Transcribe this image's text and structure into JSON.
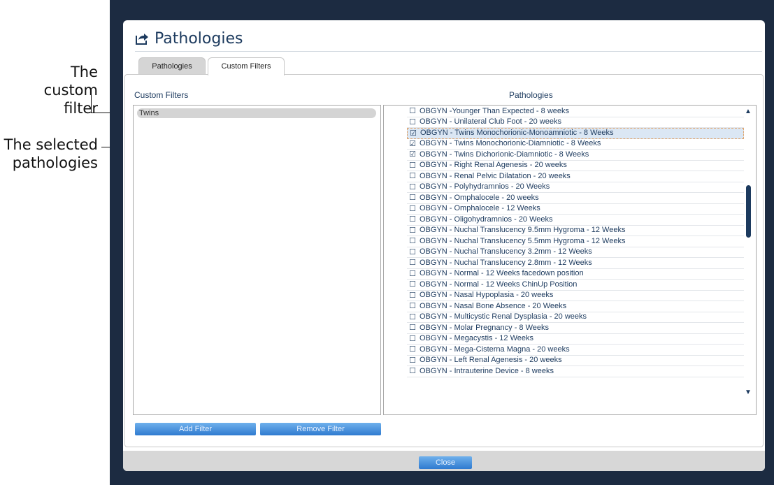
{
  "annotations": {
    "custom_filter": "The custom filter",
    "selected_pathologies": "The selected pathologies"
  },
  "dialog": {
    "title": "Pathologies",
    "icon": "export-arrow-icon"
  },
  "tabs": [
    {
      "label": "Pathologies",
      "active": false
    },
    {
      "label": "Custom Filters",
      "active": true
    }
  ],
  "custom_filters": {
    "header": "Custom Filters",
    "items": [
      "Twins"
    ]
  },
  "pathologies": {
    "header": "Pathologies",
    "items": [
      {
        "label": "OBGYN -Younger Than Expected - 8 weeks",
        "checked": false,
        "selected": false
      },
      {
        "label": "OBGYN - Unilateral Club Foot - 20 weeks",
        "checked": false,
        "selected": false
      },
      {
        "label": "OBGYN - Twins Monochorionic-Monoamniotic - 8 Weeks",
        "checked": true,
        "selected": true
      },
      {
        "label": "OBGYN - Twins Monochorionic-Diamniotic - 8 Weeks",
        "checked": true,
        "selected": false
      },
      {
        "label": "OBGYN - Twins Dichorionic-Diamniotic - 8 Weeks",
        "checked": true,
        "selected": false
      },
      {
        "label": "OBGYN - Right Renal Agenesis - 20 weeks",
        "checked": false,
        "selected": false
      },
      {
        "label": "OBGYN - Renal Pelvic Dilatation - 20 weeks",
        "checked": false,
        "selected": false
      },
      {
        "label": "OBGYN - Polyhydramnios - 20 Weeks",
        "checked": false,
        "selected": false
      },
      {
        "label": "OBGYN - Omphalocele - 20 weeks",
        "checked": false,
        "selected": false
      },
      {
        "label": "OBGYN - Omphalocele - 12 Weeks",
        "checked": false,
        "selected": false
      },
      {
        "label": "OBGYN - Oligohydramnios - 20 Weeks",
        "checked": false,
        "selected": false
      },
      {
        "label": "OBGYN - Nuchal Translucency 9.5mm Hygroma - 12 Weeks",
        "checked": false,
        "selected": false
      },
      {
        "label": "OBGYN - Nuchal Translucency 5.5mm Hygroma - 12 Weeks",
        "checked": false,
        "selected": false
      },
      {
        "label": "OBGYN - Nuchal Translucency 3.2mm - 12 Weeks",
        "checked": false,
        "selected": false
      },
      {
        "label": "OBGYN - Nuchal Translucency 2.8mm - 12 Weeks",
        "checked": false,
        "selected": false
      },
      {
        "label": "OBGYN - Normal - 12 Weeks facedown position",
        "checked": false,
        "selected": false
      },
      {
        "label": "OBGYN - Normal - 12 Weeks ChinUp Position",
        "checked": false,
        "selected": false
      },
      {
        "label": "OBGYN - Nasal Hypoplasia - 20 weeks",
        "checked": false,
        "selected": false
      },
      {
        "label": "OBGYN - Nasal Bone Absence - 20 Weeks",
        "checked": false,
        "selected": false
      },
      {
        "label": "OBGYN - Multicystic Renal Dysplasia - 20 weeks",
        "checked": false,
        "selected": false
      },
      {
        "label": "OBGYN - Molar Pregnancy - 8 Weeks",
        "checked": false,
        "selected": false
      },
      {
        "label": "OBGYN - Megacystis - 12 Weeks",
        "checked": false,
        "selected": false
      },
      {
        "label": "OBGYN - Mega-Cisterna Magna - 20 weeks",
        "checked": false,
        "selected": false
      },
      {
        "label": "OBGYN - Left Renal Agenesis - 20 weeks",
        "checked": false,
        "selected": false
      },
      {
        "label": "OBGYN - Intrauterine Device - 8 weeks",
        "checked": false,
        "selected": false
      }
    ]
  },
  "buttons": {
    "add_filter": "Add Filter",
    "remove_filter": "Remove Filter",
    "close": "Close"
  },
  "colors": {
    "frame": "#1c2b41",
    "accent": "#2f7ad0",
    "text_primary": "#1c3a5e"
  }
}
